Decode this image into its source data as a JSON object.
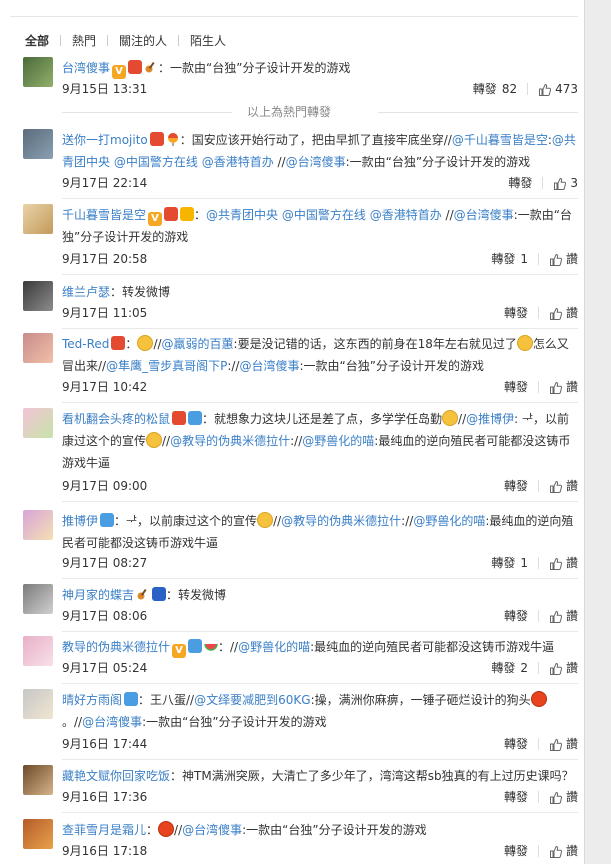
{
  "tabs": [
    "全部",
    "熱門",
    "關注的人",
    "陌生人"
  ],
  "hot_divider": "以上為熱門轉發",
  "labels": {
    "repost": "轉發",
    "like": "讚"
  },
  "colors": {
    "link": "#3a7fc7",
    "text": "#333333"
  },
  "entries": [
    {
      "user": "台湾傻事",
      "badges": [
        "v-badge-icon",
        "red-badge-icon",
        "guitar-icon"
      ],
      "text": "：一款由“台独”分子设计开发的游戏",
      "time": "9月15日 13:31",
      "reposts": "82",
      "likes": "473"
    },
    {
      "user": "送你一打mojito",
      "badges": [
        "red-badge-icon",
        "balloon-icon"
      ],
      "text_parts": [
        {
          "t": "：国安应该开始行动了，把由早抓了直接牢底坐穿//",
          "link": false
        },
        {
          "t": "@千山暮雪皆是空",
          "link": true
        },
        {
          "t": ":",
          "link": false
        },
        {
          "t": "@共青团中央",
          "link": true
        },
        {
          "t": " ",
          "link": false
        },
        {
          "t": "@中国警方在线",
          "link": true
        },
        {
          "t": " ",
          "link": false
        },
        {
          "t": "@香港特首办",
          "link": true
        },
        {
          "t": " //",
          "link": false
        },
        {
          "t": "@台湾傻事",
          "link": true
        },
        {
          "t": ":一款由“台独”分子设计开发的游戏",
          "link": false
        }
      ],
      "time": "9月17日 22:14",
      "reposts": "",
      "likes": "3"
    },
    {
      "user": "千山暮雪皆是空",
      "badges": [
        "v-badge-icon",
        "red-badge-icon",
        "crown-icon"
      ],
      "text_parts": [
        {
          "t": "：",
          "link": false
        },
        {
          "t": "@共青团中央",
          "link": true
        },
        {
          "t": " ",
          "link": false
        },
        {
          "t": "@中国警方在线",
          "link": true
        },
        {
          "t": " ",
          "link": false
        },
        {
          "t": "@香港特首办",
          "link": true
        },
        {
          "t": " //",
          "link": false
        },
        {
          "t": "@台湾傻事",
          "link": true
        },
        {
          "t": ":一款由“台独”分子设计开发的游戏",
          "link": false
        }
      ],
      "time": "9月17日 20:58",
      "reposts": "1",
      "likes": ""
    },
    {
      "user": "维兰卢瑟",
      "badges": [],
      "text": "：转发微博",
      "time": "9月17日 11:05",
      "reposts": "",
      "likes": ""
    },
    {
      "user": "Ted-Red",
      "badges": [
        "red-badge-icon"
      ],
      "text_parts": [
        {
          "t": "：",
          "link": false
        },
        {
          "t": "[emoji]",
          "link": false,
          "emoji": "sweat-smile"
        },
        {
          "t": "//",
          "link": false
        },
        {
          "t": "@羸弱的百蕙",
          "link": true
        },
        {
          "t": ":要是没记错的话，这东西的前身在18年左右就见过了",
          "link": false
        },
        {
          "t": "[emoji]",
          "link": false,
          "emoji": "smirk"
        },
        {
          "t": "怎么又冒出来//",
          "link": false
        },
        {
          "t": "@隼鹰_雪步真哥阁下P",
          "link": true
        },
        {
          "t": "://",
          "link": false
        },
        {
          "t": "@台湾傻事",
          "link": true
        },
        {
          "t": ":一款由“台独”分子设计开发的游戏",
          "link": false
        }
      ],
      "time": "9月17日 10:42",
      "reposts": "",
      "likes": ""
    },
    {
      "user": "看机翻会头疼的松鼠",
      "badges": [
        "red-badge-icon",
        "plane-icon"
      ],
      "text_parts": [
        {
          "t": "：就想象力这块儿还是差了点，多学学任岛勤",
          "link": false
        },
        {
          "t": "[emoji]",
          "link": false,
          "emoji": "think"
        },
        {
          "t": "//",
          "link": false
        },
        {
          "t": "@推博伊",
          "link": true
        },
        {
          "t": ": ᅷ，以前康过这个的宣传",
          "link": false
        },
        {
          "t": "[emoji]",
          "link": false,
          "emoji": "smile"
        },
        {
          "t": "//",
          "link": false
        },
        {
          "t": "@教导的伪典米德拉什",
          "link": true
        },
        {
          "t": "://",
          "link": false
        },
        {
          "t": "@野兽化的喵",
          "link": true
        },
        {
          "t": ":最纯血的逆向殖民者可能都没这铸币游戏牛逼",
          "link": false
        }
      ],
      "time": "9月17日 09:00",
      "reposts": "",
      "likes": ""
    },
    {
      "user": "推博伊",
      "badges": [
        "plane-icon"
      ],
      "text_parts": [
        {
          "t": "：ᅷ，以前康过这个的宣传",
          "link": false
        },
        {
          "t": "[emoji]",
          "link": false,
          "emoji": "smile"
        },
        {
          "t": "//",
          "link": false
        },
        {
          "t": "@教导的伪典米德拉什",
          "link": true
        },
        {
          "t": "://",
          "link": false
        },
        {
          "t": "@野兽化的喵",
          "link": true
        },
        {
          "t": ":最纯血的逆向殖民者可能都没这铸币游戏牛逼",
          "link": false
        }
      ],
      "time": "9月17日 08:27",
      "reposts": "1",
      "likes": ""
    },
    {
      "user": "神月家的蝶吉",
      "badges": [
        "guitar-icon",
        "flag-icon"
      ],
      "text": "：转发微博",
      "time": "9月17日 08:06",
      "reposts": "",
      "likes": ""
    },
    {
      "user": "教导的伪典米德拉什",
      "badges": [
        "v-badge-icon",
        "plane-icon",
        "melon-icon"
      ],
      "text_parts": [
        {
          "t": "：//",
          "link": false
        },
        {
          "t": "@野兽化的喵",
          "link": true
        },
        {
          "t": ":最纯血的逆向殖民者可能都没这铸币游戏牛逼",
          "link": false
        }
      ],
      "time": "9月17日 05:24",
      "reposts": "2",
      "likes": ""
    },
    {
      "user": "晴好方雨阁",
      "badges": [
        "plane-icon"
      ],
      "text_parts": [
        {
          "t": "：王八蛋//",
          "link": false
        },
        {
          "t": "@文绎要减肥到60KG",
          "link": true
        },
        {
          "t": ":操，满洲你麻痹，一锤子砸烂设计的狗头",
          "link": false
        },
        {
          "t": "[emoji]",
          "link": false,
          "emoji": "angry"
        },
        {
          "t": "。//",
          "link": false
        },
        {
          "t": "@台湾傻事",
          "link": true
        },
        {
          "t": ":一款由“台独”分子设计开发的游戏",
          "link": false
        }
      ],
      "time": "9月16日 17:44",
      "reposts": "",
      "likes": ""
    },
    {
      "user": "藏艳文赋你回家吃饭",
      "badges": [],
      "text": "：神TM满洲突厥，大清亡了多少年了，湾湾这帮sb独真的有上过历史课吗？",
      "time": "9月16日 17:36",
      "reposts": "",
      "likes": ""
    },
    {
      "user": "查菲雪月是霜儿",
      "badges": [],
      "text_parts": [
        {
          "t": "：",
          "link": false
        },
        {
          "t": "[emoji]",
          "link": false,
          "emoji": "angry"
        },
        {
          "t": "//",
          "link": false
        },
        {
          "t": "@台湾傻事",
          "link": true
        },
        {
          "t": ":一款由“台独”分子设计开发的游戏",
          "link": false
        }
      ],
      "time": "9月16日 17:18",
      "reposts": "",
      "likes": ""
    }
  ]
}
